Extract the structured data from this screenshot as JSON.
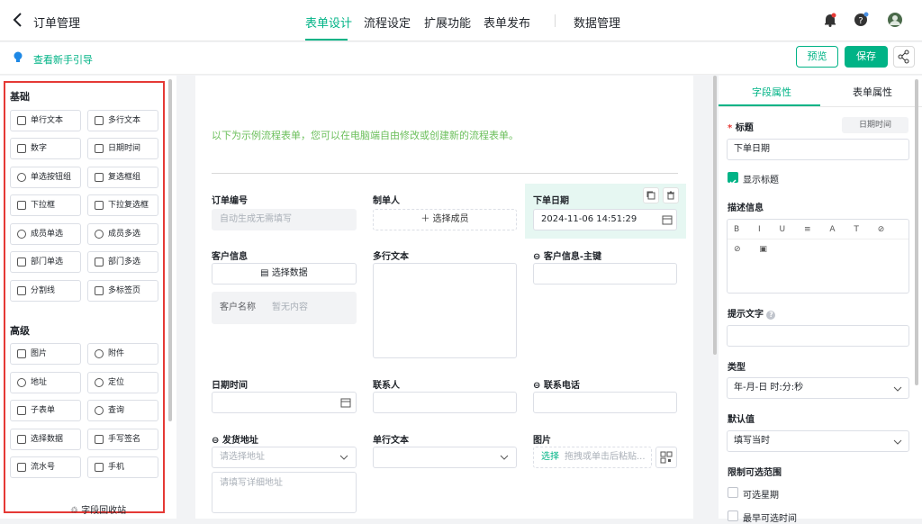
{
  "header": {
    "title": "订单管理",
    "tabs": [
      {
        "label": "表单设计",
        "active": true
      },
      {
        "label": "流程设定",
        "active": false
      },
      {
        "label": "扩展功能",
        "active": false
      },
      {
        "label": "表单发布",
        "active": false
      },
      {
        "label": "数据管理",
        "active": false
      }
    ]
  },
  "toolbar": {
    "guide_label": "查看新手引导",
    "preview_label": "预览",
    "save_label": "保存"
  },
  "left_panel": {
    "basic_title": "基础",
    "basic_items": [
      "单行文本",
      "多行文本",
      "数字",
      "日期时间",
      "单选按钮组",
      "复选框组",
      "下拉框",
      "下拉复选框",
      "成员单选",
      "成员多选",
      "部门单选",
      "部门多选",
      "分割线",
      "多标签页"
    ],
    "advanced_title": "高级",
    "advanced_items": [
      "图片",
      "附件",
      "地址",
      "定位",
      "子表单",
      "查询",
      "选择数据",
      "手写签名",
      "流水号",
      "手机"
    ],
    "recycle_label": "字段回收站"
  },
  "canvas": {
    "notice": "以下为示例流程表单，您可以在电脑端自由修改或创建新的流程表单。",
    "fields": {
      "order_no_label": "订单编号",
      "order_no_placeholder": "自动生成无需填写",
      "creator_label": "制单人",
      "creator_button": "选择成员",
      "order_date_label": "下单日期",
      "order_date_value": "2024-11-06 14:51:29",
      "customer_label": "客户信息",
      "customer_button": "选择数据",
      "customer_name_label": "客户名称",
      "customer_name_empty": "暂无内容",
      "multiline_label": "多行文本",
      "customer_key_label": "客户信息-主键",
      "datetime_label": "日期时间",
      "contact_label": "联系人",
      "phone_label": "联系电话",
      "ship_addr_label": "发货地址",
      "ship_addr_placeholder": "请选择地址",
      "ship_detail_placeholder": "请填写详细地址",
      "single_text_label": "单行文本",
      "image_label": "图片",
      "image_select": "选择",
      "image_hint": "拖拽或单击后粘贴..."
    }
  },
  "right_panel": {
    "tabs": [
      {
        "label": "字段属性",
        "active": true
      },
      {
        "label": "表单属性",
        "active": false
      }
    ],
    "title_label": "标题",
    "title_tag": "日期时间",
    "title_value": "下单日期",
    "show_title_label": "显示标题",
    "desc_label": "描述信息",
    "hint_label": "提示文字",
    "type_label": "类型",
    "type_value": "年-月-日 时:分:秒",
    "default_label": "默认值",
    "default_value": "填写当时",
    "range_label": "限制可选范围",
    "range_opt1": "可选星期",
    "range_opt2": "最早可选时间"
  },
  "colors": {
    "accent": "#00b386",
    "highlight": "#e6f7f2",
    "notice_text": "#6bbf5b",
    "annotation_red": "#e53935"
  }
}
